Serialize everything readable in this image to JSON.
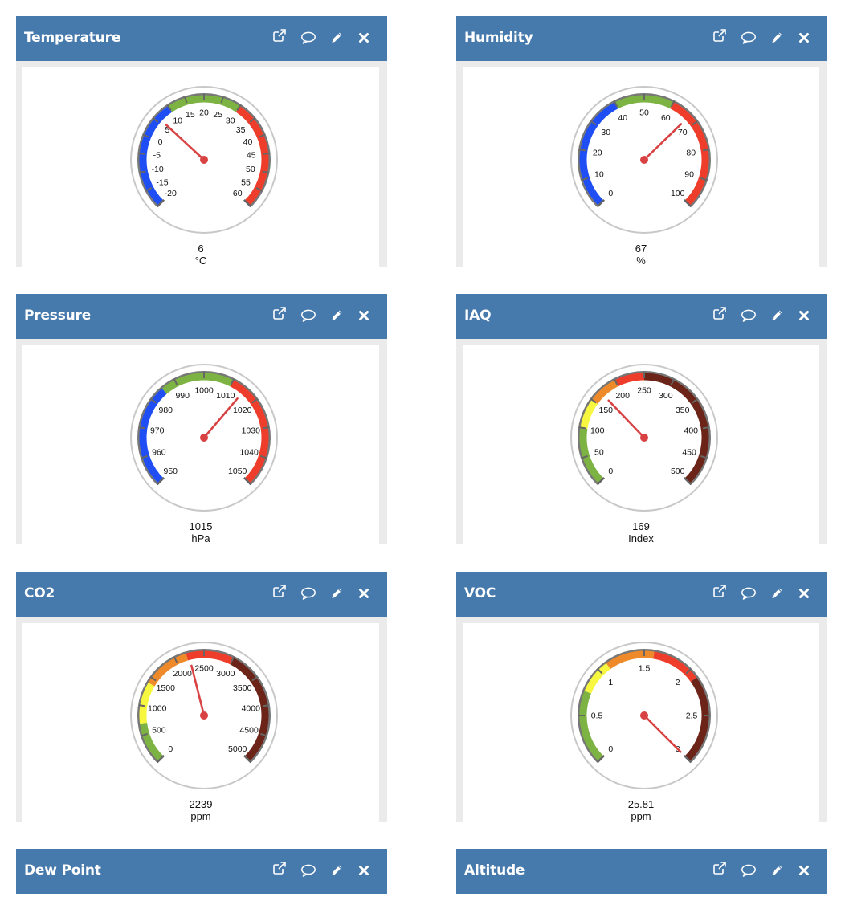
{
  "colors": {
    "header_bg": "#4679ac",
    "blue": "#1f4ef5",
    "green": "#7cb342",
    "red": "#ee3d2a",
    "yellow": "#f7f740",
    "orange": "#ef8a2a",
    "darkred": "#6b2417",
    "needle": "#d94242"
  },
  "panels": [
    {
      "title": "Temperature",
      "icons": [
        "external-link-icon",
        "comment-icon",
        "pencil-icon",
        "close-icon"
      ],
      "gauge": {
        "min": -20,
        "max": 60,
        "value": 6,
        "value_label": "6",
        "unit": "°C",
        "ticks": [
          "-20",
          "-15",
          "-10",
          "-5",
          "0",
          "5",
          "10",
          "15",
          "20",
          "25",
          "30",
          "35",
          "40",
          "45",
          "50",
          "55",
          "60"
        ],
        "bands": [
          {
            "from": -20,
            "to": 10,
            "color": "blue"
          },
          {
            "from": 10,
            "to": 30,
            "color": "green"
          },
          {
            "from": 30,
            "to": 60,
            "color": "red"
          }
        ]
      }
    },
    {
      "title": "Humidity",
      "icons": [
        "external-link-icon",
        "comment-icon",
        "pencil-icon",
        "close-icon"
      ],
      "gauge": {
        "min": 0,
        "max": 100,
        "value": 67,
        "value_label": "67",
        "unit": "%",
        "ticks": [
          "0",
          "10",
          "20",
          "30",
          "40",
          "50",
          "60",
          "70",
          "80",
          "90",
          "100"
        ],
        "bands": [
          {
            "from": 0,
            "to": 40,
            "color": "blue"
          },
          {
            "from": 40,
            "to": 60,
            "color": "green"
          },
          {
            "from": 60,
            "to": 100,
            "color": "red"
          }
        ]
      }
    },
    {
      "title": "Pressure",
      "icons": [
        "external-link-icon",
        "comment-icon",
        "pencil-icon",
        "close-icon"
      ],
      "gauge": {
        "min": 950,
        "max": 1050,
        "value": 1015,
        "value_label": "1015",
        "unit": "hPa",
        "ticks": [
          "950",
          "960",
          "970",
          "980",
          "990",
          "1000",
          "1010",
          "1020",
          "1030",
          "1040",
          "1050"
        ],
        "bands": [
          {
            "from": 950,
            "to": 985,
            "color": "blue"
          },
          {
            "from": 985,
            "to": 1010,
            "color": "green"
          },
          {
            "from": 1010,
            "to": 1050,
            "color": "red"
          }
        ]
      }
    },
    {
      "title": "IAQ",
      "icons": [
        "external-link-icon",
        "comment-icon",
        "pencil-icon",
        "close-icon"
      ],
      "gauge": {
        "min": 0,
        "max": 500,
        "value": 169,
        "value_label": "169",
        "unit": "Index",
        "ticks": [
          "0",
          "50",
          "100",
          "150",
          "200",
          "250",
          "300",
          "350",
          "400",
          "450",
          "500"
        ],
        "bands": [
          {
            "from": 0,
            "to": 100,
            "color": "green"
          },
          {
            "from": 100,
            "to": 150,
            "color": "yellow"
          },
          {
            "from": 150,
            "to": 200,
            "color": "orange"
          },
          {
            "from": 200,
            "to": 250,
            "color": "red"
          },
          {
            "from": 250,
            "to": 500,
            "color": "darkred"
          }
        ]
      }
    },
    {
      "title": "CO2",
      "icons": [
        "external-link-icon",
        "comment-icon",
        "pencil-icon",
        "close-icon"
      ],
      "gauge": {
        "min": 0,
        "max": 5000,
        "value": 2239,
        "value_label": "2239",
        "unit": "ppm",
        "ticks": [
          "0",
          "500",
          "1000",
          "1500",
          "2000",
          "2500",
          "3000",
          "3500",
          "4000",
          "4500",
          "5000"
        ],
        "bands": [
          {
            "from": 0,
            "to": 700,
            "color": "green"
          },
          {
            "from": 700,
            "to": 1400,
            "color": "yellow"
          },
          {
            "from": 1400,
            "to": 2200,
            "color": "orange"
          },
          {
            "from": 2200,
            "to": 3000,
            "color": "red"
          },
          {
            "from": 3000,
            "to": 5000,
            "color": "darkred"
          }
        ]
      }
    },
    {
      "title": "VOC",
      "icons": [
        "external-link-icon",
        "comment-icon",
        "pencil-icon",
        "close-icon"
      ],
      "gauge": {
        "min": 0,
        "max": 3,
        "value": 3,
        "value_label": "25.81",
        "unit": "ppm",
        "ticks": [
          "0",
          "0.5",
          "1",
          "1.5",
          "2",
          "2.5",
          "3"
        ],
        "bands": [
          {
            "from": 0,
            "to": 0.75,
            "color": "green"
          },
          {
            "from": 0.75,
            "to": 1.1,
            "color": "yellow"
          },
          {
            "from": 1.1,
            "to": 1.6,
            "color": "orange"
          },
          {
            "from": 1.6,
            "to": 2.1,
            "color": "red"
          },
          {
            "from": 2.1,
            "to": 3,
            "color": "darkred"
          }
        ]
      }
    },
    {
      "title": "Dew Point",
      "icons": [
        "external-link-icon",
        "comment-icon",
        "pencil-icon",
        "close-icon"
      ]
    },
    {
      "title": "Altitude",
      "icons": [
        "external-link-icon",
        "comment-icon",
        "pencil-icon",
        "close-icon"
      ]
    }
  ]
}
